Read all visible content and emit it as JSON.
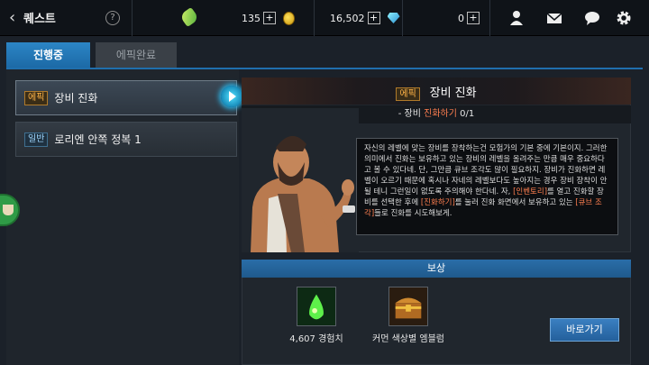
{
  "header": {
    "back_title": "퀘스트",
    "help_label": "?",
    "stamina": "135",
    "gold": "16,502",
    "gems": "0",
    "plus": "+"
  },
  "tabs": [
    {
      "label": "진행중",
      "active": true
    },
    {
      "label": "에픽완료",
      "active": false
    }
  ],
  "quests": [
    {
      "tag": "에픽",
      "name": "장비 진화",
      "selected": true
    },
    {
      "tag": "일반",
      "name": "로리엔 안쪽 정복 1",
      "selected": false
    }
  ],
  "detail": {
    "tag": "에픽",
    "title": "장비 진화",
    "subgoal_prefix": "- 장비 ",
    "subgoal_highlight": "진화하기",
    "subgoal_progress": "0/1",
    "dialog_part1": "자신의 레벨에 맞는 장비를 장착하는건 모험가의 기본 중에 기본이지. 그러한 의미에서 진화는 보유하고 있는 장비의 레벨을 올려주는 만큼 매우 중요하다고 볼 수 있다네. 단, 그만큼 큐브 조각도 많이 필요하지. 장비가 진화하면 레벨이 오르기 때문에 혹시나 자네의 레벨보다도 높아지는 경우 장비 장착이 안될 테니 그런일이 없도록 주의해야 한다네. 자, ",
    "dialog_hl1": "[인벤토리]",
    "dialog_part2": "를 열고 진화할 장비를 선택한 후에 ",
    "dialog_hl2": "[진화하기]",
    "dialog_part3": "를 눌러 진화 화면에서 보유하고 있는 ",
    "dialog_hl3": "[큐브 조각]",
    "dialog_part4": "들로 진화를 시도해보게."
  },
  "reward": {
    "header": "보상",
    "items": [
      {
        "label": "4,607 경험치",
        "icon": "exp-potion-icon"
      },
      {
        "label": "커먼 색상별 엠블럼",
        "icon": "treasure-chest-icon"
      }
    ],
    "go_button": "바로가기"
  },
  "colors": {
    "accent": "#1f6fad",
    "highlight": "#ff7f50",
    "epic": "#ffb347",
    "normal": "#9fd7ff"
  }
}
